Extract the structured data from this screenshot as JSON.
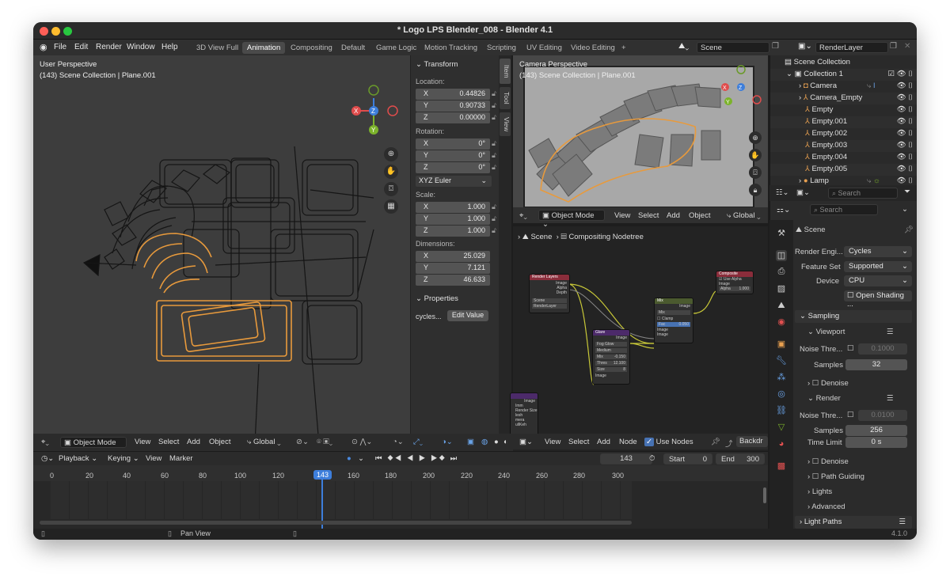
{
  "window": {
    "title": "* Logo LPS Blender_008 - Blender 4.1"
  },
  "menu": [
    "File",
    "Edit",
    "Render",
    "Window",
    "Help"
  ],
  "workspaces": [
    "3D View Full",
    "Animation",
    "Compositing",
    "Default",
    "Game Logic",
    "Motion Tracking",
    "Scripting",
    "UV Editing",
    "Video Editing",
    "+"
  ],
  "scene_field": "Scene",
  "layer_field": "RenderLayer",
  "viewport1": {
    "perspective": "User Perspective",
    "info": "(143) Scene Collection | Plane.001"
  },
  "viewport2": {
    "perspective": "Camera Perspective",
    "info": "(143) Scene Collection | Plane.001"
  },
  "npanel": {
    "transform": "Transform",
    "location_label": "Location:",
    "location": [
      {
        "k": "X",
        "v": "0.44826"
      },
      {
        "k": "Y",
        "v": "0.90733"
      },
      {
        "k": "Z",
        "v": "0.00000"
      }
    ],
    "rotation_label": "Rotation:",
    "rotation": [
      {
        "k": "X",
        "v": "0°"
      },
      {
        "k": "Y",
        "v": "0°"
      },
      {
        "k": "Z",
        "v": "0°"
      }
    ],
    "euler": "XYZ Euler",
    "scale_label": "Scale:",
    "scale": [
      {
        "k": "X",
        "v": "1.000"
      },
      {
        "k": "Y",
        "v": "1.000"
      },
      {
        "k": "Z",
        "v": "1.000"
      }
    ],
    "dimensions_label": "Dimensions:",
    "dimensions": [
      {
        "k": "X",
        "v": "25.029"
      },
      {
        "k": "Y",
        "v": "7.121"
      },
      {
        "k": "Z",
        "v": "46.633"
      }
    ],
    "properties": "Properties",
    "prop_name": "cycles...",
    "edit_value": "Edit Value",
    "tabs": [
      "Item",
      "Tool",
      "View"
    ]
  },
  "vp1_header": {
    "mode": "Object Mode",
    "items": [
      "View",
      "Select",
      "Add",
      "Object"
    ],
    "orientation": "Global"
  },
  "vp2_header": {
    "mode": "Object Mode",
    "items": [
      "View",
      "Select",
      "Add",
      "Object"
    ],
    "orientation": "Global"
  },
  "node_editor": {
    "breadcrumb_scene": "Scene",
    "breadcrumb_tree": "Compositing Nodetree",
    "items": [
      "View",
      "Select",
      "Add",
      "Node"
    ],
    "use_nodes": "Use Nodes",
    "backdrop": "Backdr"
  },
  "timeline": {
    "menus": [
      "Playback",
      "Keying",
      "View",
      "Marker"
    ],
    "current_frame": "143",
    "start_label": "Start",
    "start": "0",
    "end_label": "End",
    "end": "300",
    "ticks": [
      "0",
      "20",
      "40",
      "60",
      "80",
      "100",
      "120",
      "143",
      "160",
      "180",
      "200",
      "220",
      "240",
      "260",
      "280",
      "300"
    ]
  },
  "status": {
    "pan": "Pan View",
    "version": "4.1.0"
  },
  "outliner": {
    "root": "Scene Collection",
    "rows": [
      "Collection 1",
      "Camera",
      "Camera_Empty",
      "Empty",
      "Empty.001",
      "Empty.002",
      "Empty.003",
      "Empty.004",
      "Empty.005",
      "Lamp"
    ],
    "search": "Search"
  },
  "properties": {
    "search": "Search",
    "scene": "Scene",
    "render_engine_label": "Render Engi...",
    "render_engine": "Cycles",
    "feature_set_label": "Feature Set",
    "feature_set": "Supported",
    "device_label": "Device",
    "device": "CPU",
    "open_shading": "Open Shading ...",
    "sampling": "Sampling",
    "viewport": "Viewport",
    "noise_threshold_label": "Noise Thre...",
    "viewport_noise": "0.1000",
    "samples_label": "Samples",
    "viewport_samples": "32",
    "denoise": "Denoise",
    "render": "Render",
    "render_noise": "0.0100",
    "render_samples": "256",
    "time_limit_label": "Time Limit",
    "time_limit": "0 s",
    "path_guiding": "Path Guiding",
    "lights": "Lights",
    "advanced": "Advanced",
    "light_paths": "Light Paths"
  },
  "nodes": {
    "render_layers": {
      "title": "Render Layers",
      "outputs": [
        "Image",
        "Alpha",
        "Depth"
      ],
      "scene": "Scene",
      "layer": "RenderLayer"
    },
    "glare": {
      "title": "Glare",
      "output": "Image",
      "type": "Fog Glow",
      "quality": "Medium",
      "mix": "Mix",
      "mix_val": "-0.150",
      "thres": "Thres",
      "thres_val": "12.100",
      "size": "Size",
      "size_val": "8",
      "input": "Image"
    },
    "mix": {
      "title": "Mix",
      "output": "Image",
      "blend": "Mix",
      "clamp": "Clamp",
      "fac": "Fac",
      "fac_val": "0.050",
      "in1": "Image",
      "in2": "Image"
    },
    "composite": {
      "title": "Composite",
      "use_alpha": "Use Alpha",
      "image": "Image",
      "alpha": "Alpha",
      "alpha_val": "1.000"
    },
    "partial": {
      "output": "Image",
      "rows": [
        "Imm",
        "Render Size",
        "lesh",
        "mera",
        "ullKeh"
      ]
    }
  },
  "colors": {
    "accent": "#4772b3",
    "selection_orange": "#e89a3c",
    "frame_blue": "#3d7edb"
  }
}
